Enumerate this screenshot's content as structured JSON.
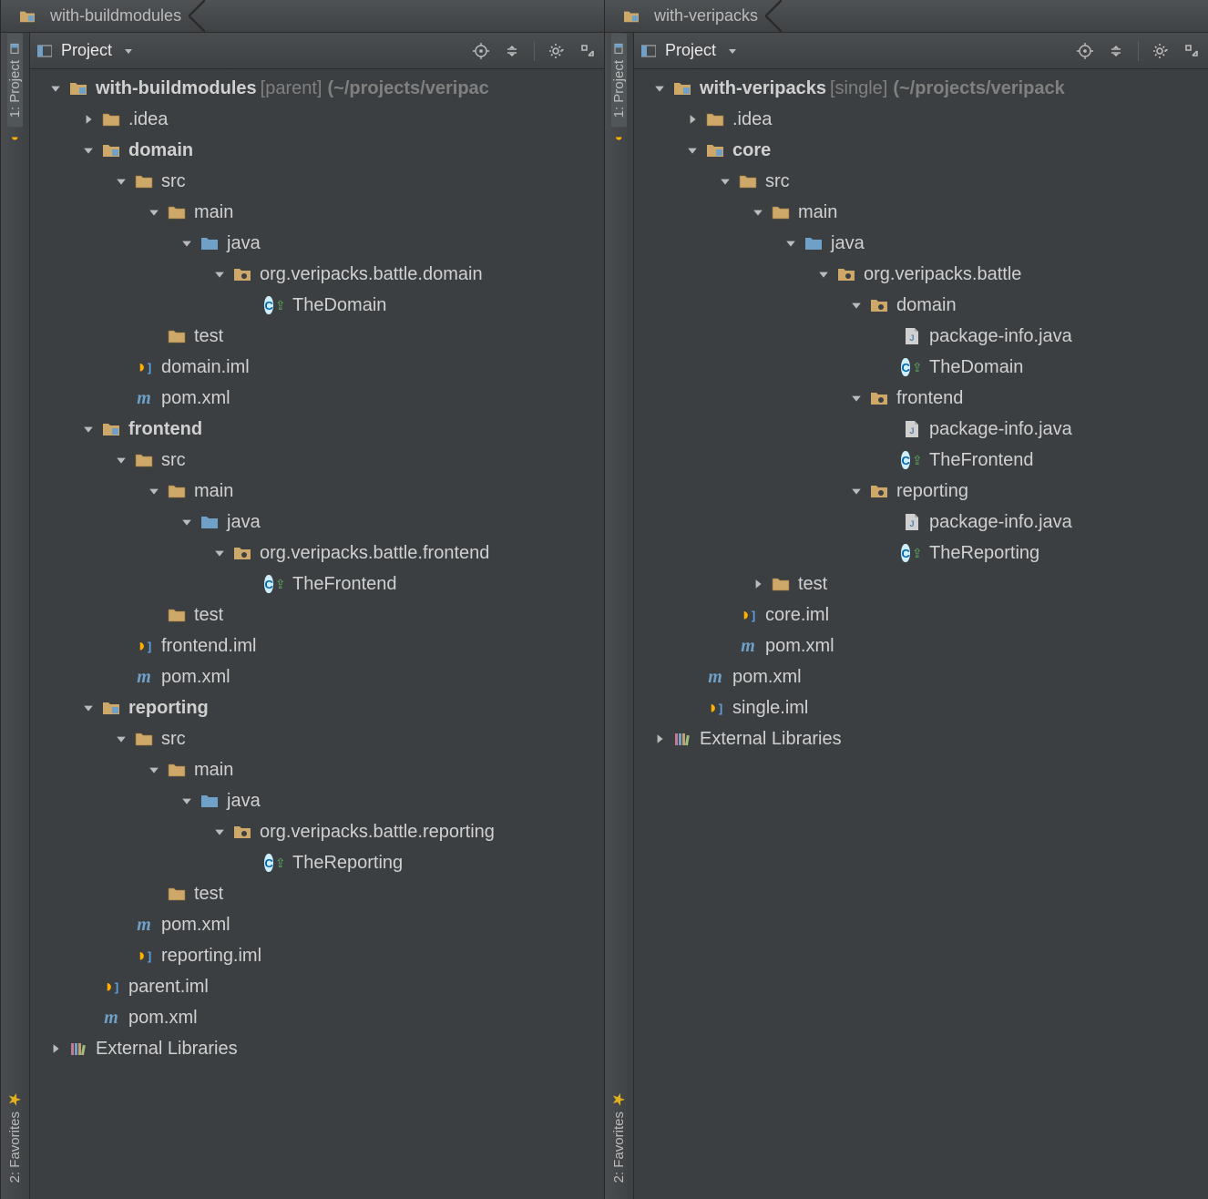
{
  "panes": [
    {
      "breadcrumb": "with-buildmodules",
      "project_label": "Project",
      "sidebar": {
        "project": "1: Project",
        "favorites": "2: Favorites"
      },
      "tree": [
        {
          "d": 0,
          "arrow": "down",
          "icon": "module",
          "bold": true,
          "text": "with-buildmodules",
          "suffix_sq": "[parent]",
          "suffix_gray": "(~/projects/veripac"
        },
        {
          "d": 1,
          "arrow": "right",
          "icon": "folder-dot",
          "text": ".idea"
        },
        {
          "d": 1,
          "arrow": "down",
          "icon": "module",
          "bold": true,
          "text": "domain"
        },
        {
          "d": 2,
          "arrow": "down",
          "icon": "folder",
          "text": "src"
        },
        {
          "d": 3,
          "arrow": "down",
          "icon": "folder",
          "text": "main"
        },
        {
          "d": 4,
          "arrow": "down",
          "icon": "folder-src",
          "text": "java"
        },
        {
          "d": 5,
          "arrow": "down",
          "icon": "package",
          "text": "org.veripacks.battle.domain"
        },
        {
          "d": 6,
          "arrow": "",
          "icon": "class",
          "text": "TheDomain"
        },
        {
          "d": 3,
          "arrow": "",
          "icon": "folder",
          "text": "test"
        },
        {
          "d": 2,
          "arrow": "",
          "icon": "iml",
          "text": "domain.iml"
        },
        {
          "d": 2,
          "arrow": "",
          "icon": "pom",
          "text": "pom.xml"
        },
        {
          "d": 1,
          "arrow": "down",
          "icon": "module",
          "bold": true,
          "text": "frontend"
        },
        {
          "d": 2,
          "arrow": "down",
          "icon": "folder",
          "text": "src"
        },
        {
          "d": 3,
          "arrow": "down",
          "icon": "folder",
          "text": "main"
        },
        {
          "d": 4,
          "arrow": "down",
          "icon": "folder-src",
          "text": "java"
        },
        {
          "d": 5,
          "arrow": "down",
          "icon": "package",
          "text": "org.veripacks.battle.frontend"
        },
        {
          "d": 6,
          "arrow": "",
          "icon": "class",
          "text": "TheFrontend"
        },
        {
          "d": 3,
          "arrow": "",
          "icon": "folder",
          "text": "test"
        },
        {
          "d": 2,
          "arrow": "",
          "icon": "iml",
          "text": "frontend.iml"
        },
        {
          "d": 2,
          "arrow": "",
          "icon": "pom",
          "text": "pom.xml"
        },
        {
          "d": 1,
          "arrow": "down",
          "icon": "module",
          "bold": true,
          "text": "reporting"
        },
        {
          "d": 2,
          "arrow": "down",
          "icon": "folder",
          "text": "src"
        },
        {
          "d": 3,
          "arrow": "down",
          "icon": "folder",
          "text": "main"
        },
        {
          "d": 4,
          "arrow": "down",
          "icon": "folder-src",
          "text": "java"
        },
        {
          "d": 5,
          "arrow": "down",
          "icon": "package",
          "text": "org.veripacks.battle.reporting"
        },
        {
          "d": 6,
          "arrow": "",
          "icon": "class",
          "text": "TheReporting"
        },
        {
          "d": 3,
          "arrow": "",
          "icon": "folder",
          "text": "test"
        },
        {
          "d": 2,
          "arrow": "",
          "icon": "pom",
          "text": "pom.xml"
        },
        {
          "d": 2,
          "arrow": "",
          "icon": "iml",
          "text": "reporting.iml"
        },
        {
          "d": 1,
          "arrow": "",
          "icon": "iml",
          "text": "parent.iml"
        },
        {
          "d": 1,
          "arrow": "",
          "icon": "pom",
          "text": "pom.xml"
        },
        {
          "d": 0,
          "arrow": "right",
          "icon": "lib",
          "text": "External Libraries"
        }
      ]
    },
    {
      "breadcrumb": "with-veripacks",
      "project_label": "Project",
      "sidebar": {
        "project": "1: Project",
        "favorites": "2: Favorites"
      },
      "tree": [
        {
          "d": 0,
          "arrow": "down",
          "icon": "module",
          "bold": true,
          "text": "with-veripacks",
          "suffix_sq": "[single]",
          "suffix_gray": "(~/projects/veripack"
        },
        {
          "d": 1,
          "arrow": "right",
          "icon": "folder-dot",
          "text": ".idea"
        },
        {
          "d": 1,
          "arrow": "down",
          "icon": "module",
          "bold": true,
          "text": "core"
        },
        {
          "d": 2,
          "arrow": "down",
          "icon": "folder",
          "text": "src"
        },
        {
          "d": 3,
          "arrow": "down",
          "icon": "folder",
          "text": "main"
        },
        {
          "d": 4,
          "arrow": "down",
          "icon": "folder-src",
          "text": "java"
        },
        {
          "d": 5,
          "arrow": "down",
          "icon": "package",
          "text": "org.veripacks.battle"
        },
        {
          "d": 6,
          "arrow": "down",
          "icon": "package",
          "text": "domain"
        },
        {
          "d": 7,
          "arrow": "",
          "icon": "javafile",
          "text": "package-info.java"
        },
        {
          "d": 7,
          "arrow": "",
          "icon": "class",
          "text": "TheDomain"
        },
        {
          "d": 6,
          "arrow": "down",
          "icon": "package",
          "text": "frontend"
        },
        {
          "d": 7,
          "arrow": "",
          "icon": "javafile",
          "text": "package-info.java"
        },
        {
          "d": 7,
          "arrow": "",
          "icon": "class",
          "text": "TheFrontend"
        },
        {
          "d": 6,
          "arrow": "down",
          "icon": "package",
          "text": "reporting"
        },
        {
          "d": 7,
          "arrow": "",
          "icon": "javafile",
          "text": "package-info.java"
        },
        {
          "d": 7,
          "arrow": "",
          "icon": "class",
          "text": "TheReporting"
        },
        {
          "d": 3,
          "arrow": "right",
          "icon": "folder",
          "text": "test"
        },
        {
          "d": 2,
          "arrow": "",
          "icon": "iml",
          "text": "core.iml"
        },
        {
          "d": 2,
          "arrow": "",
          "icon": "pom",
          "text": "pom.xml"
        },
        {
          "d": 1,
          "arrow": "",
          "icon": "pom",
          "text": "pom.xml"
        },
        {
          "d": 1,
          "arrow": "",
          "icon": "iml",
          "text": "single.iml"
        },
        {
          "d": 0,
          "arrow": "right",
          "icon": "lib",
          "text": "External Libraries"
        }
      ]
    }
  ]
}
